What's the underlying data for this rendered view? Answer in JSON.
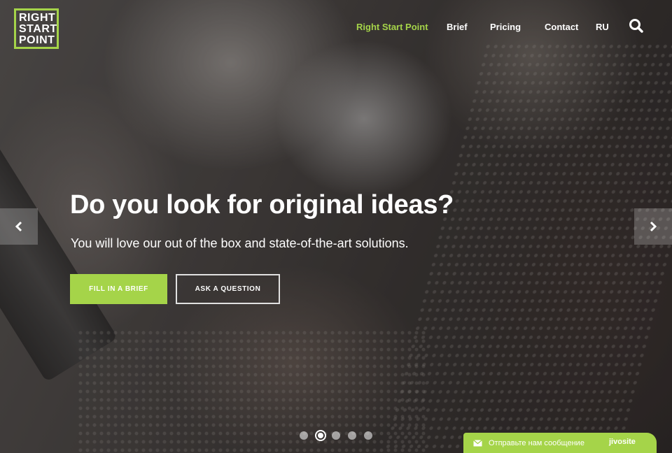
{
  "logo": {
    "lines": [
      "RIGHT",
      "START",
      "POINT"
    ]
  },
  "nav": {
    "items": [
      {
        "label": "Right Start Point",
        "active": true
      },
      {
        "label": "Brief"
      },
      {
        "label": "Pricing"
      },
      {
        "label": "Contact"
      },
      {
        "label": "RU"
      }
    ],
    "search_icon": "search-icon"
  },
  "slider": {
    "prev_icon": "chevron-left-icon",
    "next_icon": "chevron-right-icon",
    "headline": "Do you look for original ideas?",
    "subline": "You will love our out of the box and state-of-the-art solutions.",
    "primary_button": "FILL IN A BRIEF",
    "secondary_button": "ASK A QUESTION",
    "dot_count": 5,
    "active_dot": 2
  },
  "chat_widget": {
    "icon": "envelope-icon",
    "message": "Отправьте нам сообщение",
    "brand": "jivosite"
  },
  "colors": {
    "accent": "#a5d449",
    "text": "#ffffff"
  }
}
